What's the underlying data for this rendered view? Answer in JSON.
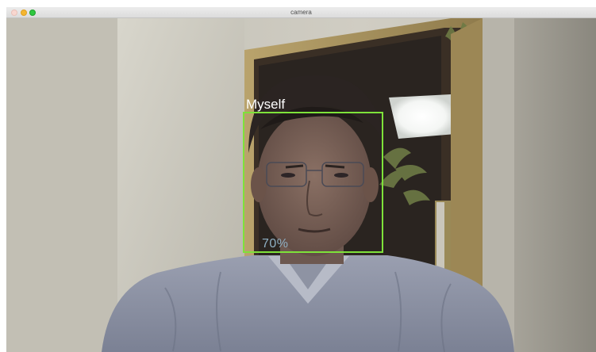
{
  "window": {
    "title": "camera"
  },
  "detection": {
    "label": "Myself",
    "confidence": "70%",
    "box_color": "#7ee23a"
  },
  "colors": {
    "close_button": "#f8d7d0",
    "minimize_button": "#f5b631",
    "zoom_button": "#2fc840"
  }
}
